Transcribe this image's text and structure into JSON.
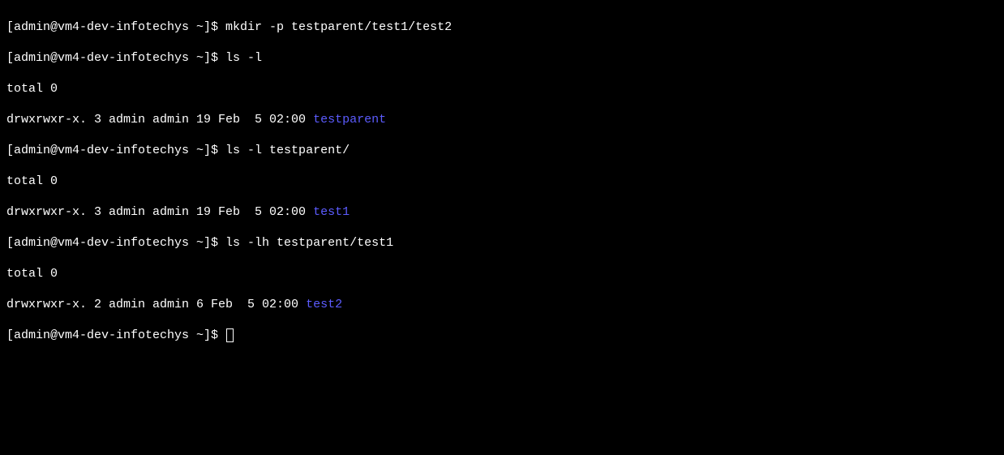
{
  "terminal": {
    "lines": [
      {
        "prompt": "[admin@vm4-dev-infotechys ~]$ ",
        "command": "mkdir -p testparent/test1/test2"
      },
      {
        "prompt": "[admin@vm4-dev-infotechys ~]$ ",
        "command": "ls -l"
      },
      {
        "output": "total 0"
      },
      {
        "output_prefix": "drwxrwxr-x. 3 admin admin 19 Feb  5 02:00 ",
        "dir_name": "testparent"
      },
      {
        "prompt": "[admin@vm4-dev-infotechys ~]$ ",
        "command": "ls -l testparent/"
      },
      {
        "output": "total 0"
      },
      {
        "output_prefix": "drwxrwxr-x. 3 admin admin 19 Feb  5 02:00 ",
        "dir_name": "test1"
      },
      {
        "prompt": "[admin@vm4-dev-infotechys ~]$ ",
        "command": "ls -lh testparent/test1"
      },
      {
        "output": "total 0"
      },
      {
        "output_prefix": "drwxrwxr-x. 2 admin admin 6 Feb  5 02:00 ",
        "dir_name": "test2"
      },
      {
        "prompt": "[admin@vm4-dev-infotechys ~]$ ",
        "cursor": true
      }
    ]
  }
}
